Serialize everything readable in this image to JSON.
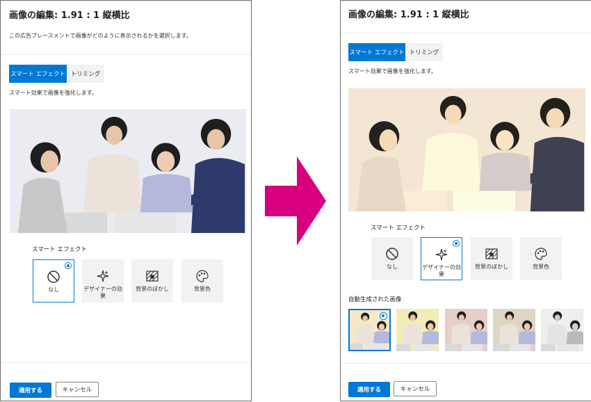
{
  "left": {
    "title": "画像の編集: 1.91 : 1 縦横比",
    "description": "この広告プレースメントで画像がどのように表示されるかを選択します。",
    "tabs": [
      "スマート エフェクト",
      "トリミング"
    ],
    "tab_description": "スマート効果で画像を強化します。",
    "effects_label": "スマート エフェクト",
    "effects": [
      "なし",
      "デザイナーの効果",
      "背景のぼかし",
      "背景色"
    ],
    "selected_effect": "なし",
    "apply_label": "適用する",
    "cancel_label": "キャンセル"
  },
  "right": {
    "title": "画像の編集: 1.91 : 1 縦横比",
    "tabs": [
      "スマート エフェクト",
      "トリミング"
    ],
    "tab_description": "スマート効果で画像を強化します。",
    "effects_label": "スマート エフェクト",
    "effects": [
      "なし",
      "デザイナーの効果",
      "背景のぼかし",
      "背景色"
    ],
    "selected_effect": "デザイナーの効果",
    "generated_label": "自動生成された画像",
    "apply_label": "適用する",
    "cancel_label": "キャンセル"
  },
  "icons": {
    "none": "no-entry-icon",
    "designer": "sparkle-icon",
    "blur": "blur-background-icon",
    "color": "palette-icon"
  },
  "colors": {
    "accent": "#0078d4",
    "arrow": "#d8007f",
    "tab_inactive": "#f3f2f1"
  }
}
